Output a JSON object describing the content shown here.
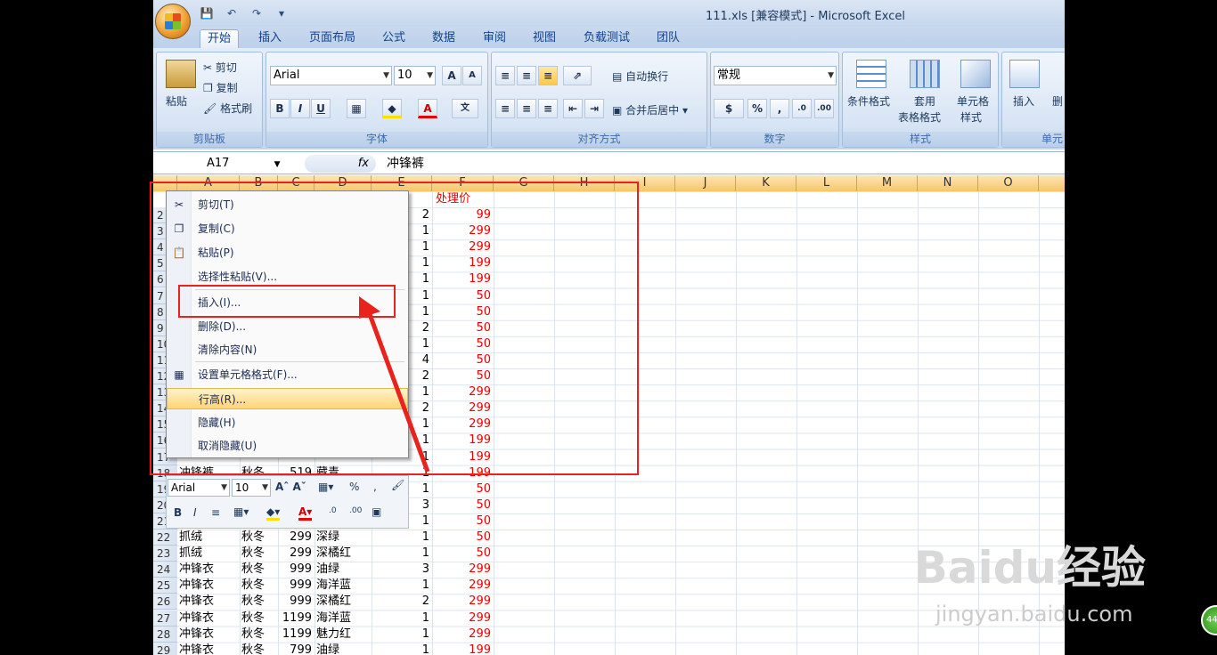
{
  "window": {
    "title": "111.xls  [兼容模式] - Microsoft Excel"
  },
  "tabs": [
    "开始",
    "插入",
    "页面布局",
    "公式",
    "数据",
    "审阅",
    "视图",
    "负载测试",
    "团队"
  ],
  "ribbon": {
    "clipboard": {
      "paste": "粘贴",
      "cut": "剪切",
      "copy": "复制",
      "format_painter": "格式刷",
      "label": "剪贴板"
    },
    "font": {
      "name": "Arial",
      "size": "10",
      "label": "字体"
    },
    "alignment": {
      "wrap": "自动换行",
      "merge": "合并后居中",
      "label": "对齐方式"
    },
    "number": {
      "format": "常规",
      "label": "数字"
    },
    "styles": {
      "conditional": "条件格式",
      "table_format_1": "套用",
      "table_format_2": "表格格式",
      "cell_style_1": "单元格",
      "cell_style_2": "样式",
      "label": "样式"
    },
    "cells": {
      "insert": "插入",
      "delete": "删",
      "label": "单元"
    }
  },
  "formula_bar": {
    "name_box": "A17",
    "fx": "fx",
    "content": "冲锋裤"
  },
  "columns": [
    "A",
    "B",
    "C",
    "D",
    "E",
    "F",
    "G",
    "H",
    "I",
    "J",
    "K",
    "L",
    "M",
    "N",
    "O"
  ],
  "header_cell": "处理价",
  "visible_rows": [
    {
      "row": "2",
      "e": "2",
      "f": "99"
    },
    {
      "row": "3",
      "e": "1",
      "f": "299"
    },
    {
      "row": "4",
      "e": "1",
      "f": "299"
    },
    {
      "row": "5",
      "e": "1",
      "f": "199"
    },
    {
      "row": "6",
      "e": "1",
      "f": "199"
    },
    {
      "row": "7",
      "e": "1",
      "f": "50"
    },
    {
      "row": "8",
      "e": "1",
      "f": "50"
    },
    {
      "row": "9",
      "e": "2",
      "f": "50"
    },
    {
      "row": "10",
      "e": "1",
      "f": "50"
    },
    {
      "row": "11",
      "e": "4",
      "f": "50"
    },
    {
      "row": "12",
      "e": "2",
      "f": "50"
    },
    {
      "row": "13",
      "e": "1",
      "f": "299"
    },
    {
      "row": "14",
      "e": "2",
      "f": "299"
    },
    {
      "row": "15",
      "e": "1",
      "f": "299"
    },
    {
      "row": "16",
      "e": "1",
      "f": "199"
    },
    {
      "row": "17",
      "e": "1",
      "f": "199"
    },
    {
      "row": "18",
      "a": "冲锋裤",
      "b": "秋冬",
      "c": "519",
      "d": "藏青",
      "e": "1",
      "f": "199"
    },
    {
      "row": "19",
      "e": "1",
      "f": "50"
    },
    {
      "row": "20",
      "e": "3",
      "f": "50"
    },
    {
      "row": "21",
      "e": "1",
      "f": "50"
    },
    {
      "row": "22",
      "a": "抓绒",
      "b": "秋冬",
      "c": "299",
      "d": "深绿",
      "e": "1",
      "f": "50"
    },
    {
      "row": "23",
      "a": "抓绒",
      "b": "秋冬",
      "c": "299",
      "d": "深橘红",
      "e": "1",
      "f": "50"
    },
    {
      "row": "24",
      "a": "冲锋衣",
      "b": "秋冬",
      "c": "999",
      "d": "油绿",
      "e": "3",
      "f": "299"
    },
    {
      "row": "25",
      "a": "冲锋衣",
      "b": "秋冬",
      "c": "999",
      "d": "海洋蓝",
      "e": "1",
      "f": "299"
    },
    {
      "row": "26",
      "a": "冲锋衣",
      "b": "秋冬",
      "c": "999",
      "d": "深橘红",
      "e": "2",
      "f": "299"
    },
    {
      "row": "27",
      "a": "冲锋衣",
      "b": "秋冬",
      "c": "1199",
      "d": "海洋蓝",
      "e": "1",
      "f": "299"
    },
    {
      "row": "28",
      "a": "冲锋衣",
      "b": "秋冬",
      "c": "1199",
      "d": "魅力红",
      "e": "1",
      "f": "299"
    },
    {
      "row": "29",
      "a": "冲锋衣",
      "b": "秋冬",
      "c": "799",
      "d": "油绿",
      "e": "1",
      "f": "199"
    }
  ],
  "context_menu": [
    "剪切(T)",
    "复制(C)",
    "粘贴(P)",
    "选择性粘贴(V)...",
    "插入(I)...",
    "删除(D)...",
    "清除内容(N)",
    "设置单元格格式(F)...",
    "行高(R)...",
    "隐藏(H)",
    "取消隐藏(U)"
  ],
  "mini_toolbar": {
    "font": "Arial",
    "size": "10"
  },
  "watermark": {
    "brand": "Baidu经验",
    "url": "jingyan.baidu.com"
  },
  "badge": "44"
}
